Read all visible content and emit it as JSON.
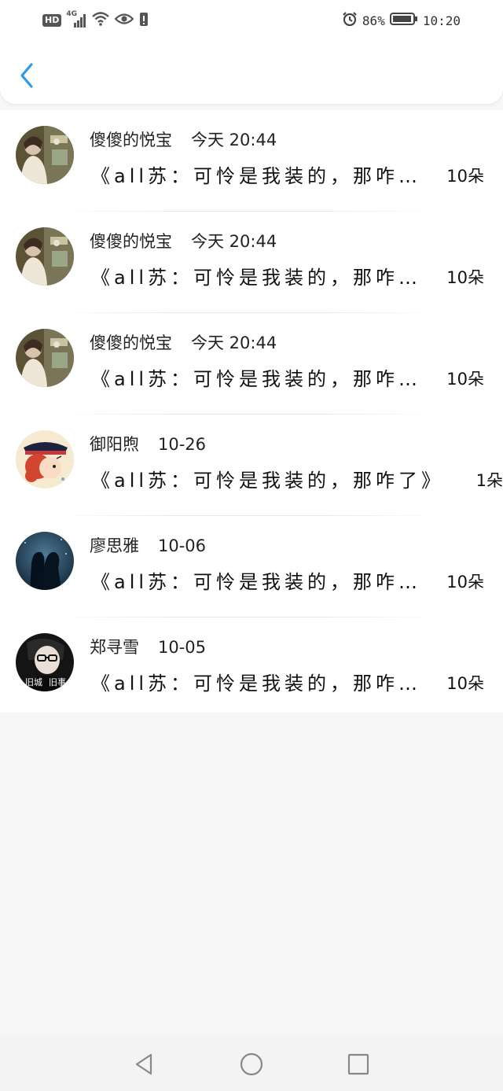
{
  "status_bar": {
    "hd_label": "HD",
    "network": "4G",
    "battery_percent": "86%",
    "time": "10:20"
  },
  "header": {
    "back_icon": "chevron-left-icon",
    "accent": "#2c9be6"
  },
  "items": [
    {
      "name": "傻傻的悦宝",
      "date": "今天 20:44",
      "message": "《all苏：可怜是我装的，那咋…",
      "count": "10朵",
      "avatar": "photo-girl-room"
    },
    {
      "name": "傻傻的悦宝",
      "date": "今天 20:44",
      "message": "《all苏：可怜是我装的，那咋…",
      "count": "10朵",
      "avatar": "photo-girl-room"
    },
    {
      "name": "傻傻的悦宝",
      "date": "今天 20:44",
      "message": "《all苏：可怜是我装的，那咋…",
      "count": "10朵",
      "avatar": "photo-girl-room"
    },
    {
      "name": "御阳煦",
      "date": "10-26",
      "message": "《all苏：可怜是我装的，那咋了》",
      "count": "1朵",
      "avatar": "cartoon-red-hair-girl"
    },
    {
      "name": "廖思雅",
      "date": "10-06",
      "message": "《all苏：可怜是我装的，那咋…",
      "count": "10朵",
      "avatar": "couple-silhouette-night"
    },
    {
      "name": "郑寻雪",
      "date": "10-05",
      "message": "《all苏：可怜是我装的，那咋…",
      "count": "10朵",
      "avatar": "man-glasses-dark"
    }
  ],
  "avatar_labels": {
    "left": "旧城",
    "right": "旧事"
  },
  "nav": {
    "back": "triangle-back-icon",
    "home": "circle-home-icon",
    "recent": "square-recent-icon"
  }
}
